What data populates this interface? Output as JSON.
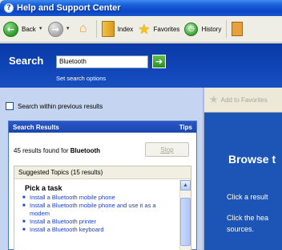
{
  "window": {
    "title": "Help and Support Center"
  },
  "toolbar": {
    "back_label": "Back",
    "index_label": "Index",
    "favorites_label": "Favorites",
    "history_label": "History"
  },
  "search": {
    "label": "Search",
    "value": "Bluetooth",
    "options_link": "Set search options"
  },
  "left_pane": {
    "previous_results_label": "Search within previous results",
    "results_header": "Search Results",
    "tips_label": "Tips",
    "count_text": "45 results found for",
    "count_term": "Bluetooth",
    "stop_label": "Stop",
    "suggested_header": "Suggested Topics (15 results)",
    "pick_task": "Pick a task",
    "items": [
      "Install a Bluetooth mobile phone",
      "Install a Bluetooth mobile phone and use it as a modem",
      "Install a Bluetooth printer",
      "Install a Bluetooth keyboard"
    ]
  },
  "right_pane": {
    "add_favorites_label": "Add to Favorites",
    "browse_title": "Browse t",
    "line1": "Click a result",
    "line2": "Click the hea",
    "line3": "sources."
  }
}
